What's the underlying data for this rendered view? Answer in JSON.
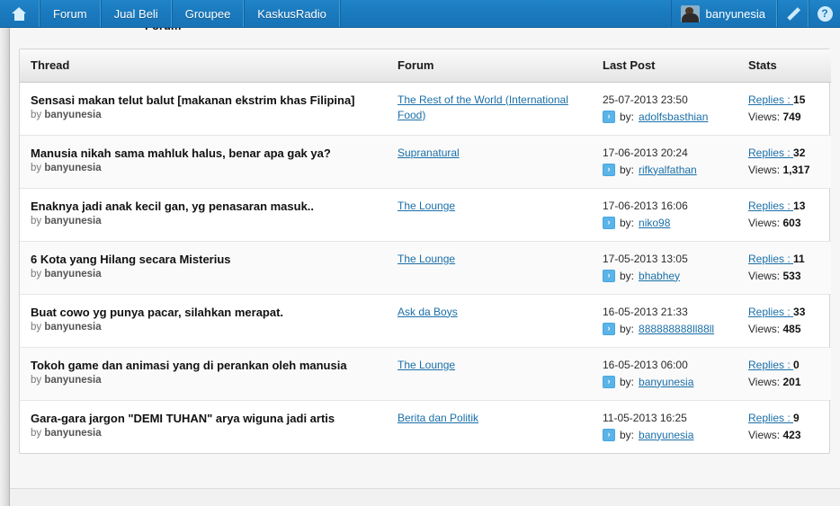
{
  "navbar": {
    "home_icon": "home-icon",
    "items": [
      {
        "label": "Forum"
      },
      {
        "label": "Jual Beli"
      },
      {
        "label": "Groupee"
      },
      {
        "label": "KaskusRadio"
      }
    ],
    "user": {
      "name": "banyunesia",
      "avatar_icon": "user-avatar"
    },
    "edit_icon": "pencil-icon",
    "help_icon": "question-mark-icon",
    "help_glyph": "?",
    "background_color": "#1a79bd"
  },
  "table": {
    "headers": {
      "thread": "Thread",
      "forum": "Forum",
      "last_post": "Last Post",
      "stats": "Stats"
    },
    "by_prefix": "by ",
    "lastpost_by_prefix": "by:",
    "goto_icon": "goto-post-arrow-icon",
    "goto_glyph": "›",
    "rows": [
      {
        "title": "Sensasi makan telut balut [makanan ekstrim khas Filipina]",
        "author": "banyunesia",
        "forum": "The Rest of the World (International Food)",
        "date": "25-07-2013 23:50",
        "last_poster": "adolfsbasthian",
        "replies_label": "Replies : ",
        "replies": "15",
        "views_label": "Views: ",
        "views": "749"
      },
      {
        "title": "Manusia nikah sama mahluk halus, benar apa gak ya?",
        "author": "banyunesia",
        "forum": "Supranatural",
        "date": "17-06-2013 20:24",
        "last_poster": "rifkyalfathan",
        "replies_label": "Replies : ",
        "replies": "32",
        "views_label": "Views: ",
        "views": "1,317"
      },
      {
        "title": "Enaknya jadi anak kecil gan, yg penasaran masuk..",
        "author": "banyunesia",
        "forum": "The Lounge",
        "date": "17-06-2013 16:06",
        "last_poster": "niko98",
        "replies_label": "Replies : ",
        "replies": "13",
        "views_label": "Views: ",
        "views": "603"
      },
      {
        "title": "6 Kota yang Hilang secara Misterius",
        "author": "banyunesia",
        "forum": "The Lounge",
        "date": "17-05-2013 13:05",
        "last_poster": "bhabhey",
        "replies_label": "Replies : ",
        "replies": "11",
        "views_label": "Views: ",
        "views": "533"
      },
      {
        "title": "Buat cowo yg punya pacar, silahkan merapat.",
        "author": "banyunesia",
        "forum": "Ask da Boys",
        "date": "16-05-2013 21:33",
        "last_poster": "888888888ll88ll",
        "replies_label": "Replies : ",
        "replies": "33",
        "views_label": "Views: ",
        "views": "485"
      },
      {
        "title": "Tokoh game dan animasi yang di perankan oleh manusia",
        "author": "banyunesia",
        "forum": "The Lounge",
        "date": "16-05-2013 06:00",
        "last_poster": "banyunesia",
        "replies_label": "Replies : ",
        "replies": "0",
        "views_label": "Views: ",
        "views": "201"
      },
      {
        "title": "Gara-gara jargon \"DEMI TUHAN\" arya wiguna jadi artis",
        "author": "banyunesia",
        "forum": "Berita dan Politik",
        "date": "11-05-2013 16:25",
        "last_poster": "banyunesia",
        "replies_label": "Replies : ",
        "replies": "9",
        "views_label": "Views: ",
        "views": "423"
      }
    ]
  },
  "colors": {
    "link": "#1a6fa8",
    "nav_blue": "#1a79bd",
    "goto_icon": "#5bb4e8"
  }
}
